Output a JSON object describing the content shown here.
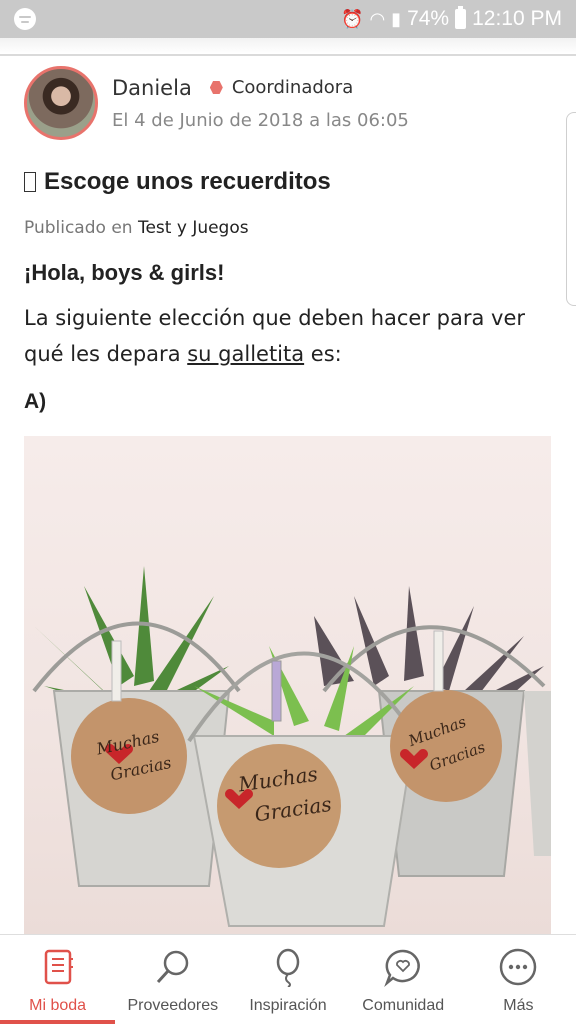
{
  "statusbar": {
    "battery": "74%",
    "time": "12:10 PM"
  },
  "post": {
    "author_name": "Daniela",
    "author_role": "Coordinadora",
    "date": "El 4 de Junio de 2018 a las 06:05",
    "title": "Escoge unos recuerditos",
    "published_prefix": "Publicado en",
    "category": "Test y Juegos",
    "greeting": "¡Hola, boys & girls!",
    "paragraph_start": "La siguiente elección que deben hacer para ver qué les depara ",
    "paragraph_link": "su galletita",
    "paragraph_end": " es:",
    "option_label": "A)"
  },
  "image": {
    "tag_line1": "Muchas",
    "tag_line2": "Gracias"
  },
  "nav": {
    "items": [
      {
        "label": "Mi boda",
        "icon": "notebook-icon",
        "active": true
      },
      {
        "label": "Proveedores",
        "icon": "search-icon",
        "active": false
      },
      {
        "label": "Inspiración",
        "icon": "balloon-icon",
        "active": false
      },
      {
        "label": "Comunidad",
        "icon": "chat-heart-icon",
        "active": false
      },
      {
        "label": "Más",
        "icon": "more-icon",
        "active": false
      }
    ]
  },
  "colors": {
    "accent": "#e0514a",
    "avatar_border": "#e8736c"
  }
}
